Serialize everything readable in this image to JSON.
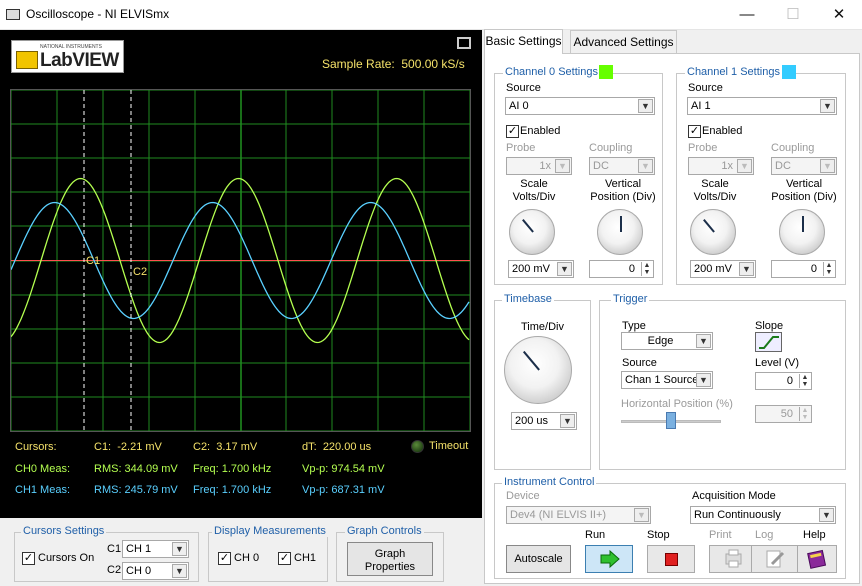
{
  "window": {
    "title": "Oscilloscope - NI ELVISmx",
    "minimize": "—",
    "maximize": "☐",
    "close": "✕"
  },
  "logo": {
    "small_text": "NATIONAL INSTRUMENTS",
    "name": "LabVIEW"
  },
  "sample_rate": {
    "label": "Sample Rate:",
    "value": "500.00 kS/s"
  },
  "plot": {
    "cursor1_label": "C1",
    "cursor2_label": "C2",
    "colors": {
      "ch0": "#b4ff50",
      "ch1": "#5ad0ff",
      "grid": "#1f8a1f",
      "cursor": "#ffffff",
      "trigger": "#ff5050"
    }
  },
  "measurements": {
    "cursors_label": "Cursors:",
    "c1_label": "C1:",
    "c1_value": "-2.21 mV",
    "c2_label": "C2:",
    "c2_value": "3.17 mV",
    "dt_label": "dT:",
    "dt_value": "220.00 us",
    "timeout_label": "Timeout",
    "ch0_label": "CH0 Meas:",
    "ch0_rms": "RMS: 344.09 mV",
    "ch0_freq": "Freq: 1.700 kHz",
    "ch0_vpp": "Vp-p: 974.54 mV",
    "ch1_label": "CH1 Meas:",
    "ch1_rms": "RMS: 245.79 mV",
    "ch1_freq": "Freq: 1.700 kHz",
    "ch1_vpp": "Vp-p: 687.31 mV"
  },
  "cursors_settings": {
    "title": "Cursors Settings",
    "cursors_on_label": "Cursors On",
    "cursors_on": true,
    "c1_label": "C1",
    "c1_value": "CH 1",
    "c2_label": "C2",
    "c2_value": "CH 0"
  },
  "display_measurements": {
    "title": "Display Measurements",
    "ch0_label": "CH 0",
    "ch1_label": "CH1"
  },
  "graph_controls": {
    "title": "Graph Controls",
    "button": "Graph Properties"
  },
  "tabs": {
    "basic": "Basic Settings",
    "advanced": "Advanced Settings"
  },
  "channel0": {
    "title": "Channel 0 Settings",
    "color": "#66ff00",
    "source_label": "Source",
    "source": "AI 0",
    "enabled_label": "Enabled",
    "probe_label": "Probe",
    "probe": "1x",
    "coupling_label": "Coupling",
    "coupling": "DC",
    "scale_label": "Scale Volts/Div",
    "scale": "200 mV",
    "vpos_label": "Vertical Position (Div)",
    "vpos": "0"
  },
  "channel1": {
    "title": "Channel 1 Settings",
    "color": "#33ccff",
    "source_label": "Source",
    "source": "AI 1",
    "enabled_label": "Enabled",
    "probe_label": "Probe",
    "probe": "1x",
    "coupling_label": "Coupling",
    "coupling": "DC",
    "scale_label": "Scale Volts/Div",
    "scale": "200 mV",
    "vpos_label": "Vertical Position (Div)",
    "vpos": "0"
  },
  "timebase": {
    "title": "Timebase",
    "label": "Time/Div",
    "value": "200 us"
  },
  "trigger": {
    "title": "Trigger",
    "type_label": "Type",
    "type": "Edge",
    "slope_label": "Slope",
    "source_label": "Source",
    "source": "Chan 1 Source",
    "level_label": "Level (V)",
    "level": "0",
    "hpos_label": "Horizontal Position (%)",
    "hpos": "50"
  },
  "instrument_control": {
    "title": "Instrument Control",
    "device_label": "Device",
    "device": "Dev4 (NI ELVIS II+)",
    "acq_label": "Acquisition Mode",
    "acq": "Run Continuously",
    "autoscale": "Autoscale",
    "run_label": "Run",
    "stop_label": "Stop",
    "print_label": "Print",
    "log_label": "Log",
    "help_label": "Help"
  }
}
